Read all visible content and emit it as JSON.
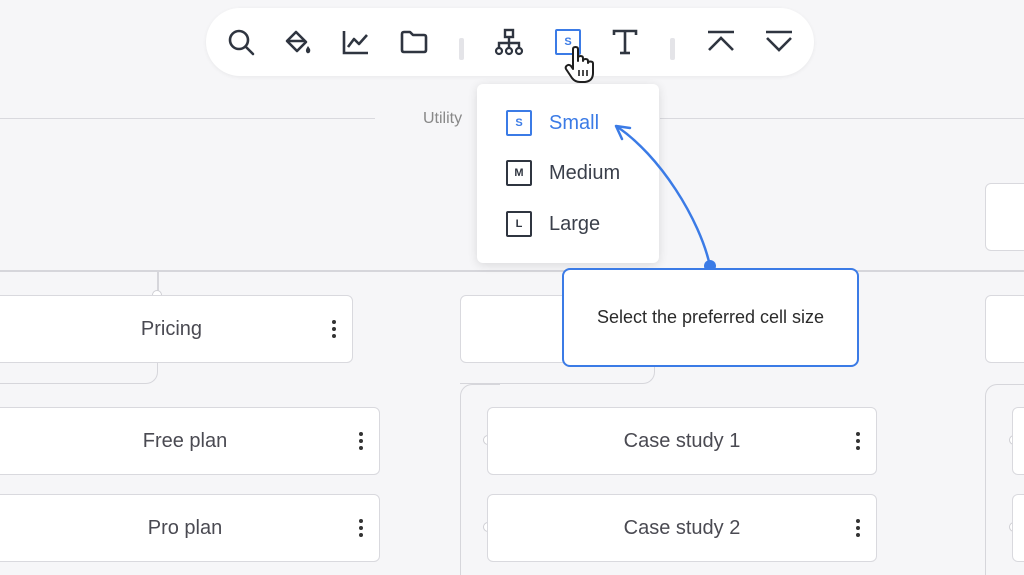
{
  "toolbar": {
    "tools": [
      {
        "name": "search-icon"
      },
      {
        "name": "paint-bucket-icon"
      },
      {
        "name": "line-chart-icon"
      },
      {
        "name": "folder-icon"
      },
      {
        "name": "sitemap-icon"
      },
      {
        "name": "cell-size-icon",
        "glyph": "S",
        "active": true
      },
      {
        "name": "text-icon"
      },
      {
        "name": "collapse-up-icon"
      },
      {
        "name": "expand-down-icon"
      }
    ]
  },
  "dropdown": {
    "items": [
      {
        "icon_letter": "S",
        "label": "Small",
        "active": true
      },
      {
        "icon_letter": "M",
        "label": "Medium",
        "active": false
      },
      {
        "icon_letter": "L",
        "label": "Large",
        "active": false
      }
    ]
  },
  "section": {
    "label": "Utility"
  },
  "cards": {
    "pricing": "Pricing",
    "free_plan": "Free plan",
    "pro_plan": "Pro plan",
    "case_study_1": "Case study 1",
    "case_study_2": "Case study 2"
  },
  "callout": {
    "text": "Select the preferred cell size"
  },
  "colors": {
    "accent": "#3b7be6",
    "background": "#f6f6f8",
    "card_border": "#d9d9de"
  }
}
